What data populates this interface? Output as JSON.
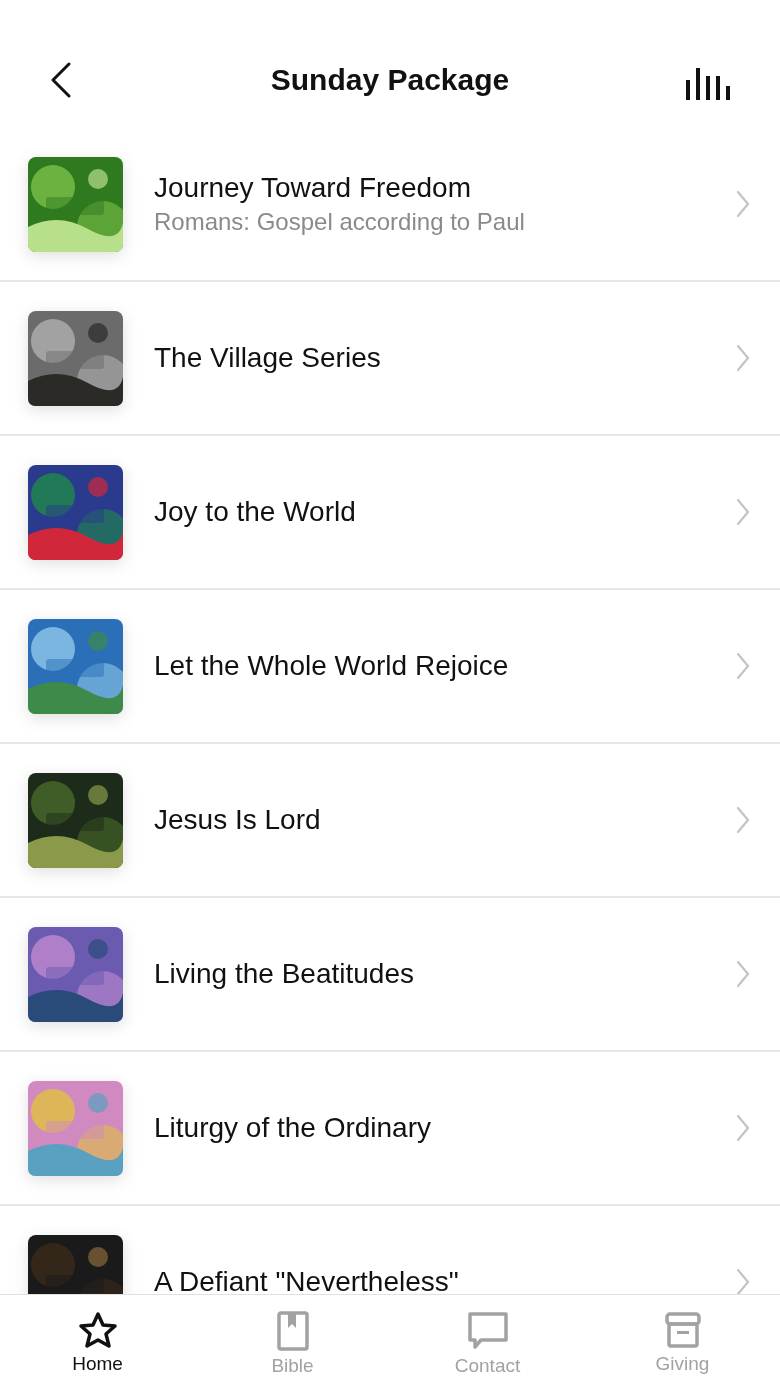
{
  "header": {
    "title": "Sunday Package"
  },
  "series": [
    {
      "title": "Journey Toward Freedom",
      "subtitle": "Romans: Gospel according to Paul"
    },
    {
      "title": "The Village Series"
    },
    {
      "title": "Joy to the World"
    },
    {
      "title": "Let the Whole World Rejoice"
    },
    {
      "title": "Jesus Is Lord"
    },
    {
      "title": "Living the Beatitudes"
    },
    {
      "title": "Liturgy of the Ordinary"
    },
    {
      "title": "A Defiant \"Nevertheless\""
    }
  ],
  "tabs": [
    {
      "label": "Home",
      "selected": true
    },
    {
      "label": "Bible",
      "selected": false
    },
    {
      "label": "Contact",
      "selected": false
    },
    {
      "label": "Giving",
      "selected": false
    }
  ]
}
